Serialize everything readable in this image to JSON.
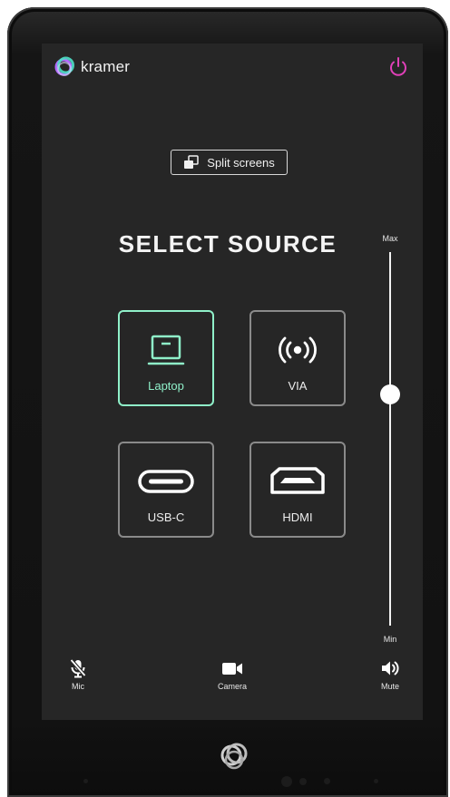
{
  "brand": {
    "name": "kramer",
    "accent": "#e040b8"
  },
  "header": {
    "split_label": "Split screens"
  },
  "main": {
    "title": "SELECT SOURCE",
    "active_color": "#8ff0c9",
    "sources": [
      {
        "label": "Laptop",
        "icon": "laptop-icon",
        "selected": true
      },
      {
        "label": "VIA",
        "icon": "wireless-icon",
        "selected": false
      },
      {
        "label": "USB-C",
        "icon": "usb-c-icon",
        "selected": false
      },
      {
        "label": "HDMI",
        "icon": "hdmi-icon",
        "selected": false
      }
    ]
  },
  "volume": {
    "max_label": "Max",
    "min_label": "Min",
    "level": 0.62
  },
  "footer": {
    "mic_label": "Mic",
    "mic_muted": true,
    "camera_label": "Camera",
    "mute_label": "Mute"
  }
}
